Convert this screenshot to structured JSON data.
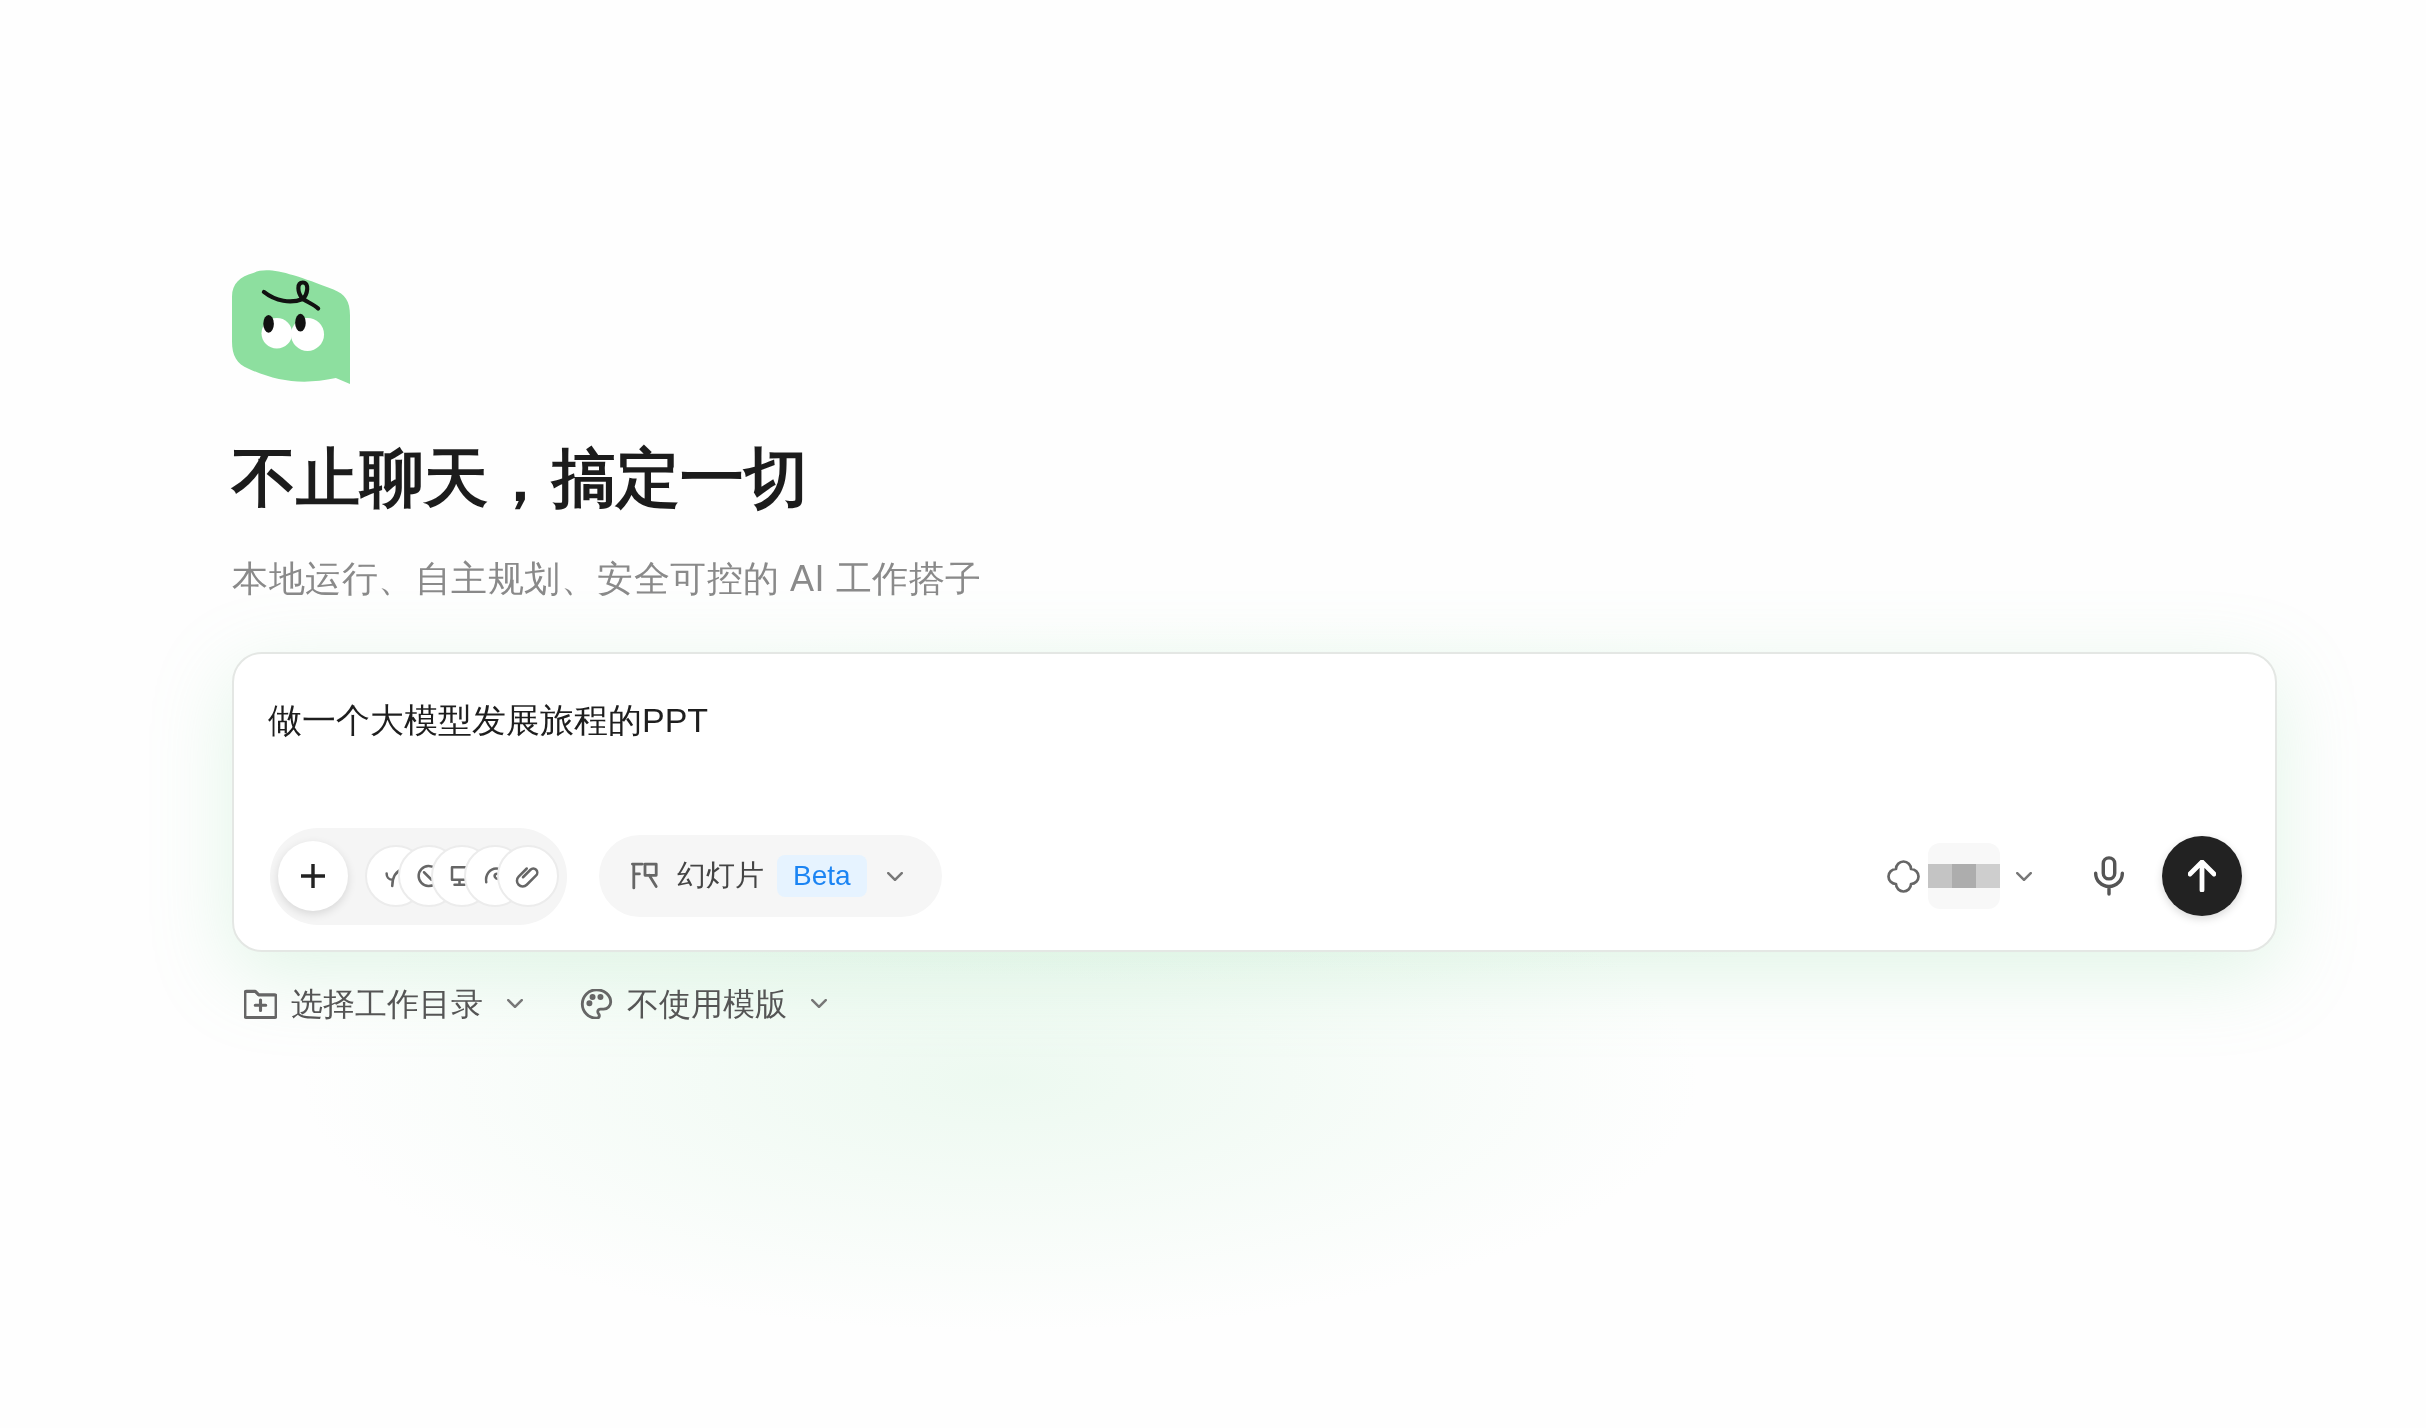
{
  "hero": {
    "title": "不止聊天，搞定一切",
    "subtitle": "本地运行、自主规划、安全可控的 AI 工作搭子"
  },
  "composer": {
    "value": "做一个大模型发展旅程的PPT",
    "mode": {
      "label": "幻灯片",
      "badge": "Beta"
    }
  },
  "options": [
    {
      "kind": "folder",
      "label": "选择工作目录"
    },
    {
      "kind": "template",
      "label": "不使用模版"
    }
  ]
}
